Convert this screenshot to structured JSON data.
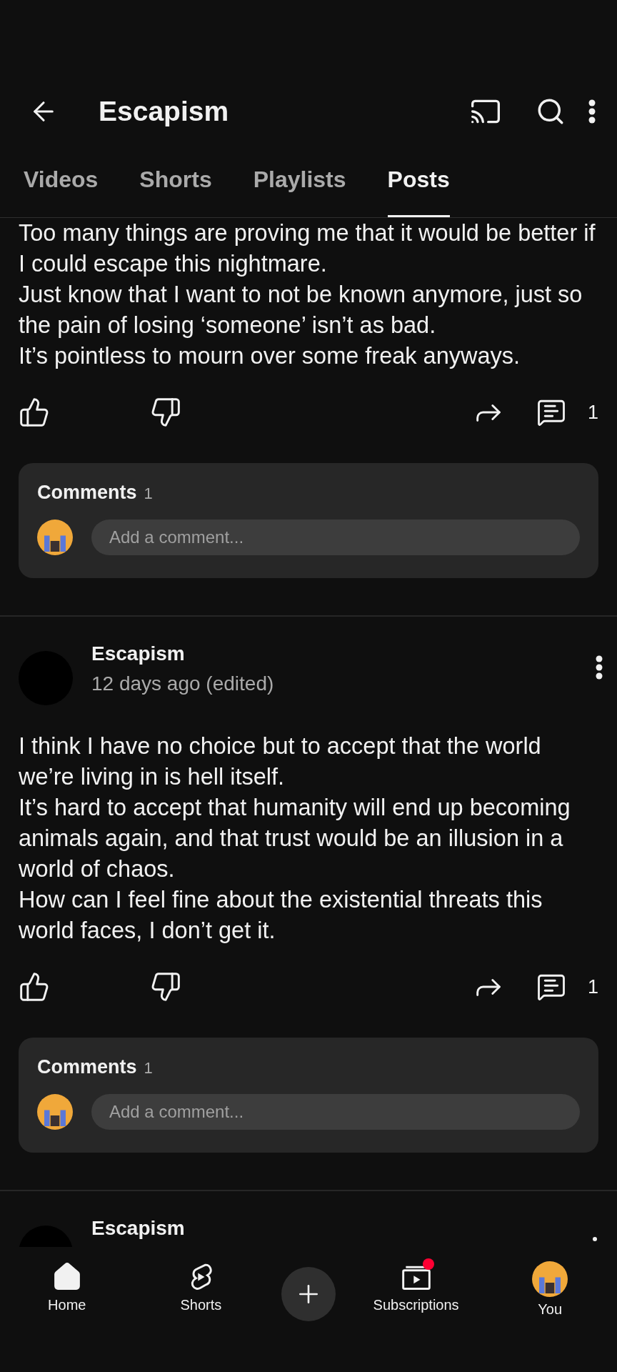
{
  "header": {
    "title": "Escapism"
  },
  "tabs": [
    {
      "label": "Videos",
      "selected": false
    },
    {
      "label": "Shorts",
      "selected": false
    },
    {
      "label": "Playlists",
      "selected": false
    },
    {
      "label": "Posts",
      "selected": true
    }
  ],
  "posts": [
    {
      "paragraphs": [
        "Too many things are proving me that it would be better if I could escape this nightmare.",
        "Just know that I want to not be known anymore, just so the pain of losing ‘someone’ isn’t as bad.",
        "It’s pointless to mourn over some freak anyways."
      ],
      "comment_count": "1",
      "comments": {
        "title": "Comments",
        "count": "1",
        "placeholder": "Add a comment..."
      }
    },
    {
      "author": "Escapism",
      "time": "12 days ago (edited)",
      "paragraphs": [
        "I think I have no choice but to accept that the world we’re living in is hell itself.",
        "It’s hard to accept that humanity will end up becoming animals again, and that trust would be an illusion in a world of chaos.",
        "How can I feel fine about the existential threats this world faces, I don’t get it."
      ],
      "comment_count": "1",
      "comments": {
        "title": "Comments",
        "count": "1",
        "placeholder": "Add a comment..."
      }
    },
    {
      "author": "Escapism"
    }
  ],
  "nav": [
    {
      "kind": "home",
      "label": "Home",
      "selected": true
    },
    {
      "kind": "shorts",
      "label": "Shorts",
      "selected": false
    },
    {
      "kind": "create"
    },
    {
      "kind": "subscriptions",
      "label": "Subscriptions",
      "selected": false,
      "notification": true
    },
    {
      "kind": "you",
      "label": "You",
      "selected": false
    }
  ]
}
